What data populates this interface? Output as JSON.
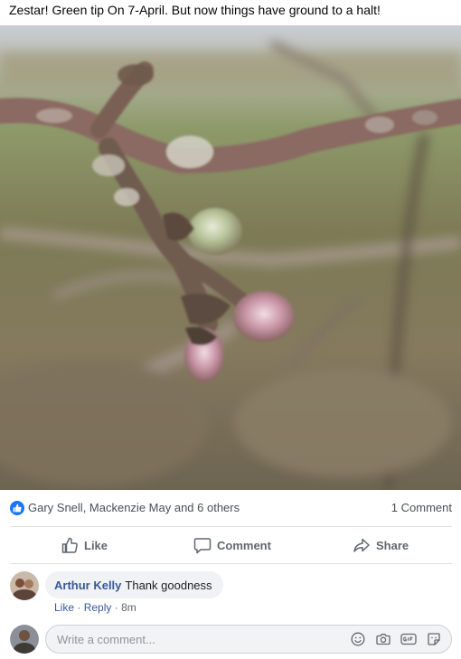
{
  "post": {
    "text": "Zestar! Green tip On 7-April. But now things have ground to a halt!"
  },
  "reactions": {
    "names": "Gary Snell, Mackenzie May and 6 others",
    "comment_count": "1 Comment",
    "badge_color": "#1877f2"
  },
  "actions": {
    "like_label": "Like",
    "comment_label": "Comment",
    "share_label": "Share"
  },
  "comment": {
    "author": "Arthur Kelly",
    "text": "Thank goodness",
    "like_label": "Like",
    "separator": "·",
    "reply_label": "Reply",
    "time": "8m"
  },
  "write_comment": {
    "placeholder": "Write a comment...",
    "icons": [
      "emoji-icon",
      "camera-icon",
      "gif-icon",
      "sticker-icon"
    ]
  },
  "colors": {
    "link": "#385898",
    "secondary_text": "#606770",
    "divider": "#dddfe2"
  }
}
